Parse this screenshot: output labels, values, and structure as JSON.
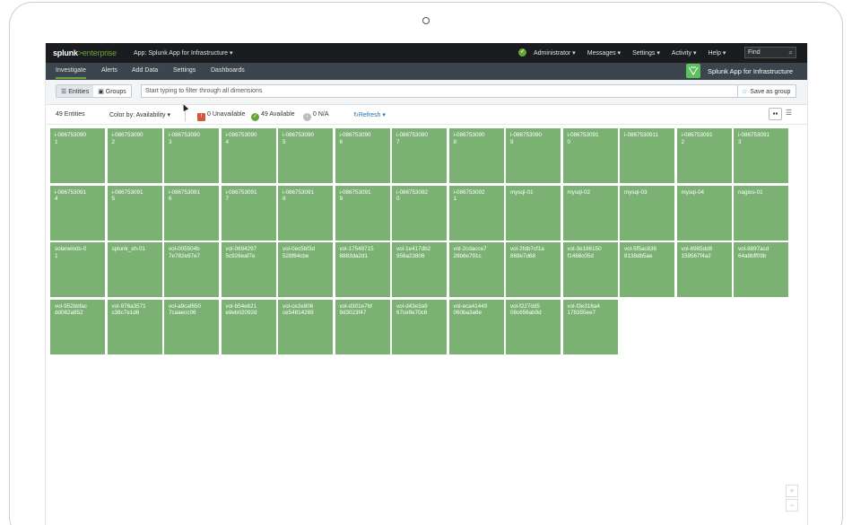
{
  "topnav": {
    "logo_main": "splunk",
    "logo_accent": ">enterprise",
    "app_menu": "App: Splunk App for Infrastructure ▾",
    "status_icon": "check-circle",
    "user": "Administrator ▾",
    "messages": "Messages ▾",
    "settings": "Settings ▾",
    "activity": "Activity ▾",
    "help": "Help ▾",
    "find_placeholder": "Find"
  },
  "appbar": {
    "items": [
      "Investigate",
      "Alerts",
      "Add Data",
      "Settings",
      "Dashboards"
    ],
    "active": "Investigate",
    "app_title": "Splunk App for Infrastructure"
  },
  "filter": {
    "entities_label": "Entities",
    "groups_label": "Groups",
    "placeholder": "Start typing to filter through all dimensions",
    "save_label": "Save as group"
  },
  "summary": {
    "count": "49 Entities",
    "color_by": "Color by: Availability ▾",
    "unavailable_count": "0",
    "unavailable_label": "Unavailable",
    "available_count": "49",
    "available_label": "Available",
    "na_count": "0",
    "na_label": "N/A",
    "refresh": "Refresh ▾"
  },
  "colors": {
    "tile_available": "#7bb274",
    "accent": "#65a637"
  },
  "tiles": [
    "i-086753090\n1",
    "i-086753090\n2",
    "i-086753090\n3",
    "i-086753090\n4",
    "i-086753090\n5",
    "i-086753090\n6",
    "i-086753090\n7",
    "i-086753090\n8",
    "i-086753090\n9",
    "i-086753091\n0",
    "i-0867530911",
    "i-086753091\n2",
    "i-086753091\n3",
    "i-086753091\n4",
    "i-086753091\n5",
    "i-086753091\n6",
    "i-086753091\n7",
    "i-086753091\n8",
    "i-086753091\n9",
    "i-086753092\n0",
    "i-086753092\n1",
    "mysql-01",
    "mysql-02",
    "mysql-03",
    "mysql-04",
    "nagios-01",
    "solarwinds-0\n1",
    "splunk_sh-01",
    "vol-005504b\n7e782e97e7",
    "vol-0694297\n5c926eaf7e",
    "vol-0ec5bf3d\n528f64cbe",
    "vol-17549715\n8883da2d1",
    "vol-1e417db2\n956a23806",
    "vol-2cdacce7\n28b6e791c",
    "vol-2fdb7cf1a\n869e7d68",
    "vol-3e186150\nf1468c05d",
    "vol-5f5ac836\n8138db5ae",
    "vol-6985dd8\n159567f4a2",
    "vol-8897acd\n64a8bff09b",
    "vol-952bbfac\ndd082a852",
    "vol-976a3571\nc38c7e1d6",
    "vol-a9caf650\n7caaecc06",
    "vol-b54e621\ne9eb02092d",
    "vol-ce2e806\nce54814269",
    "vol-d301e7bf\n9d3023f47",
    "vol-d43e3a9\n67ce9e70c6",
    "vol-eca41449\n060ba3a6e",
    "vol-f227dd5\n08c656ab9d",
    "vol-f3e316a4\n178355ee7"
  ],
  "zoom": {
    "in": "+",
    "out": "−"
  }
}
